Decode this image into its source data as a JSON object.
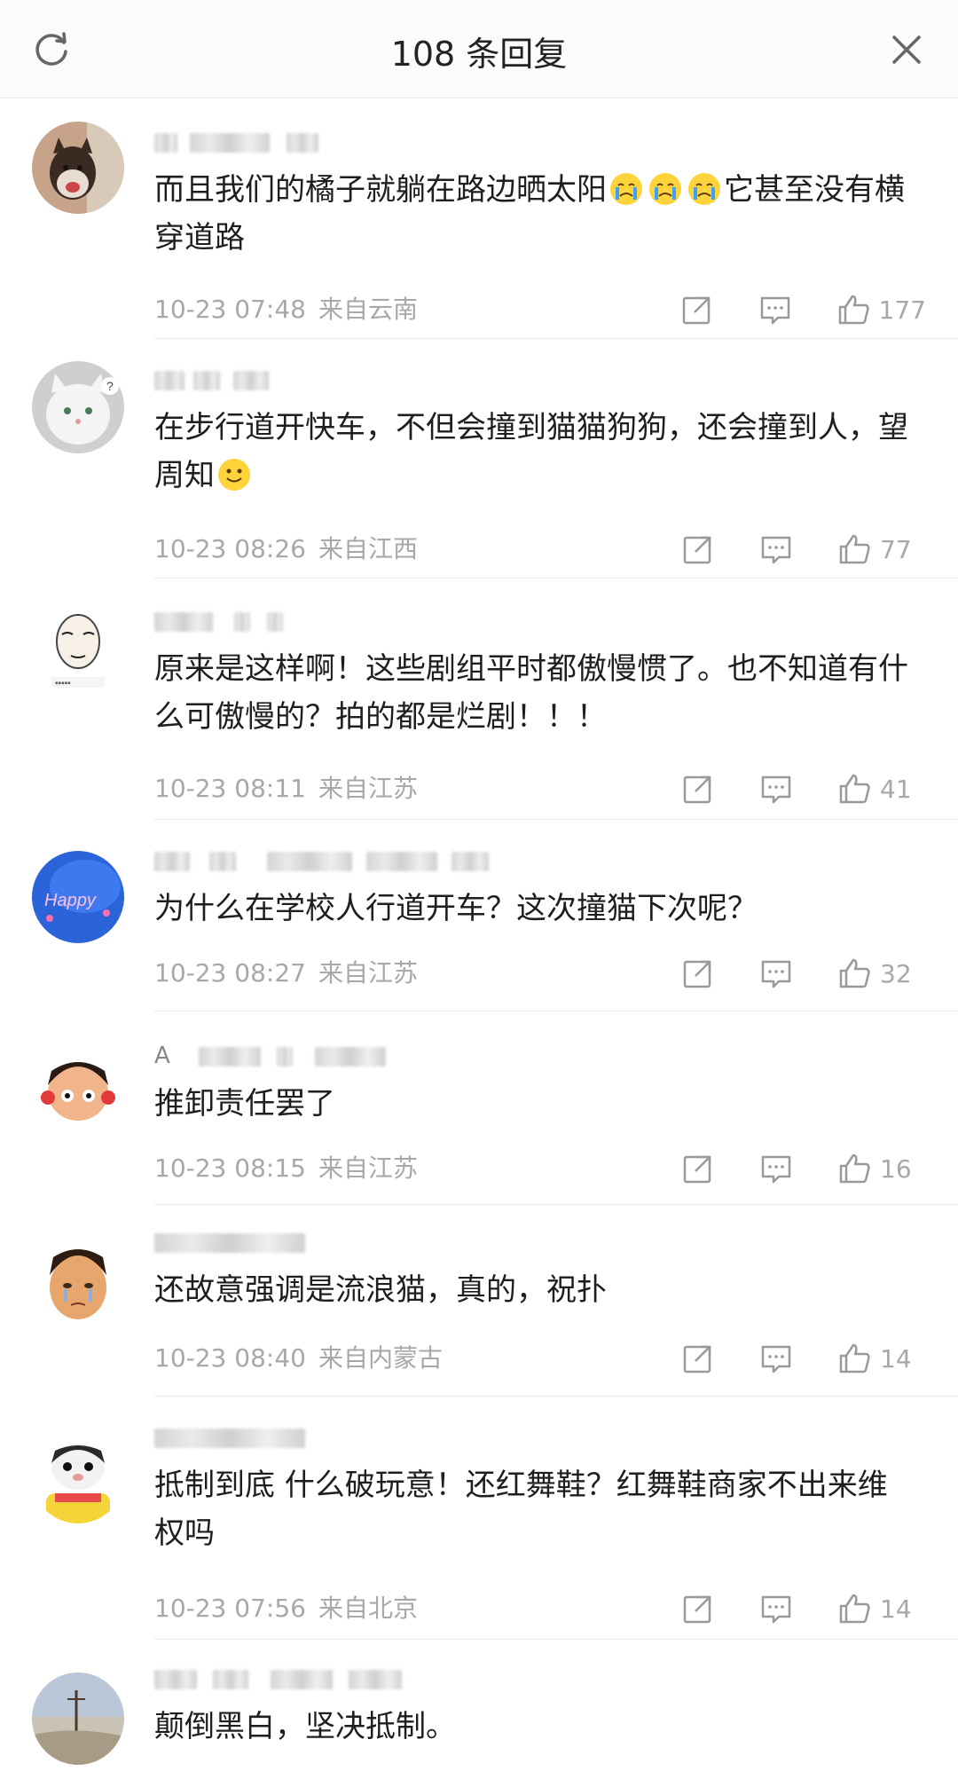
{
  "header": {
    "title": "108 条回复"
  },
  "comments": [
    {
      "name_prefix": "",
      "text_a": "而且我们的橘子就躺在路边晒太阳",
      "text_b": "它甚至没有横穿道路",
      "time": "10-23 07:48",
      "location": "来自云南",
      "likes": "177"
    },
    {
      "name_prefix": "",
      "text_a": "在步行道开快车，不但会撞到猫猫狗狗，还会撞到人，望周知",
      "text_b": "",
      "time": "10-23 08:26",
      "location": "来自江西",
      "likes": "77"
    },
    {
      "name_prefix": "",
      "text_a": "原来是这样啊！这些剧组平时都傲慢惯了。也不知道有什么可傲慢的？拍的都是烂剧！！！",
      "text_b": "",
      "time": "10-23 08:11",
      "location": "来自江苏",
      "likes": "41"
    },
    {
      "name_prefix": "",
      "text_a": "为什么在学校人行道开车？这次撞猫下次呢？",
      "text_b": "",
      "time": "10-23 08:27",
      "location": "来自江苏",
      "likes": "32"
    },
    {
      "name_prefix": "A",
      "text_a": "推卸责任罢了",
      "text_b": "",
      "time": "10-23 08:15",
      "location": "来自江苏",
      "likes": "16"
    },
    {
      "name_prefix": "",
      "text_a": "还故意强调是流浪猫，真的，祝扑",
      "text_b": "",
      "time": "10-23 08:40",
      "location": "来自内蒙古",
      "likes": "14"
    },
    {
      "name_prefix": "",
      "text_a": "抵制到底 什么破玩意！还红舞鞋？红舞鞋商家不出来维权吗",
      "text_b": "",
      "time": "10-23 07:56",
      "location": "来自北京",
      "likes": "14"
    },
    {
      "name_prefix": "",
      "text_a": "颠倒黑白，坚决抵制。",
      "text_b": "",
      "time": "",
      "location": "",
      "likes": ""
    }
  ]
}
